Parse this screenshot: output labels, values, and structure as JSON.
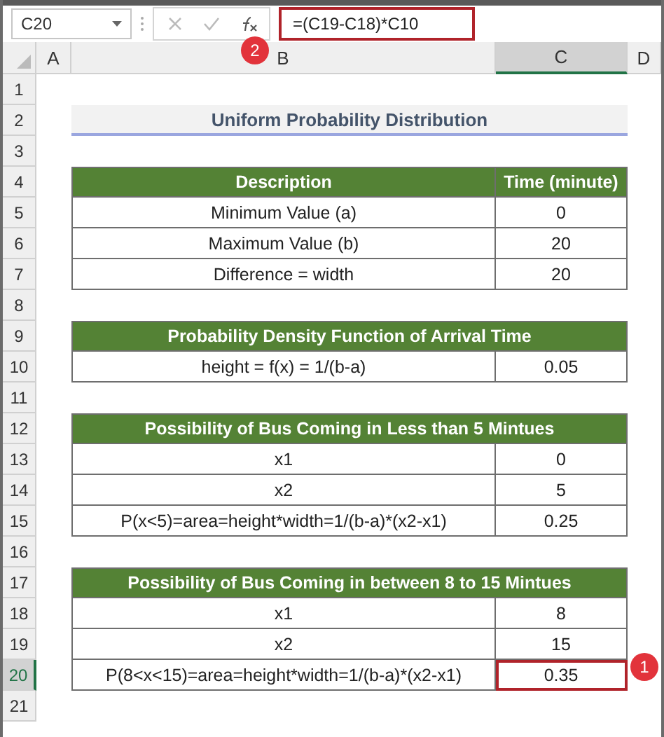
{
  "formula_bar": {
    "name_box": "C20",
    "formula": "=(C19-C18)*C10"
  },
  "callouts": [
    {
      "label": "2",
      "kind": "formula"
    },
    {
      "label": "1",
      "kind": "cell"
    }
  ],
  "columns": [
    {
      "label": "A",
      "selected": false
    },
    {
      "label": "B",
      "selected": false
    },
    {
      "label": "C",
      "selected": true
    },
    {
      "label": "D",
      "selected": false
    }
  ],
  "rows": [
    {
      "number": "1",
      "kind": "blank",
      "selected": false
    },
    {
      "number": "2",
      "kind": "title",
      "selected": false,
      "text": "Uniform Probability Distribution"
    },
    {
      "number": "3",
      "kind": "blank",
      "selected": false
    },
    {
      "number": "4",
      "kind": "header",
      "selected": false,
      "cells": [
        "Description",
        "Time (minute)"
      ]
    },
    {
      "number": "5",
      "kind": "data",
      "selected": false,
      "cells": [
        "Minimum Value (a)",
        "0"
      ]
    },
    {
      "number": "6",
      "kind": "data",
      "selected": false,
      "cells": [
        "Maximum Value (b)",
        "20"
      ]
    },
    {
      "number": "7",
      "kind": "data",
      "selected": false,
      "cells": [
        "Difference = width",
        "20"
      ]
    },
    {
      "number": "8",
      "kind": "blank",
      "selected": false
    },
    {
      "number": "9",
      "kind": "banner",
      "selected": false,
      "text": "Probability Density Function of Arrival Time"
    },
    {
      "number": "10",
      "kind": "data",
      "selected": false,
      "cells": [
        "height = f(x) = 1/(b-a)",
        "0.05"
      ]
    },
    {
      "number": "11",
      "kind": "blank",
      "selected": false
    },
    {
      "number": "12",
      "kind": "banner",
      "selected": false,
      "text": "Possibility of Bus Coming in Less than 5 Mintues"
    },
    {
      "number": "13",
      "kind": "data",
      "selected": false,
      "cells": [
        "x1",
        "0"
      ]
    },
    {
      "number": "14",
      "kind": "data",
      "selected": false,
      "cells": [
        "x2",
        "5"
      ]
    },
    {
      "number": "15",
      "kind": "data",
      "selected": false,
      "cells": [
        "P(x<5)=area=height*width=1/(b-a)*(x2-x1)",
        "0.25"
      ]
    },
    {
      "number": "16",
      "kind": "blank",
      "selected": false
    },
    {
      "number": "17",
      "kind": "banner",
      "selected": false,
      "text": "Possibility of Bus Coming in between 8 to 15 Mintues"
    },
    {
      "number": "18",
      "kind": "data",
      "selected": false,
      "cells": [
        "x1",
        "8"
      ]
    },
    {
      "number": "19",
      "kind": "data",
      "selected": false,
      "cells": [
        "x2",
        "15"
      ]
    },
    {
      "number": "20",
      "kind": "data",
      "selected": true,
      "cells": [
        "P(8<x<15)=area=height*width=1/(b-a)*(x2-x1)",
        "0.35"
      ]
    },
    {
      "number": "21",
      "kind": "blank",
      "selected": false
    }
  ]
}
